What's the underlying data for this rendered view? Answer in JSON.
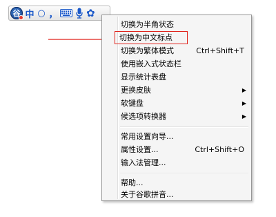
{
  "ime_bar": {
    "logo_text": "谷",
    "mode": "中",
    "fullhalf": "○",
    "punct": "，",
    "keyboard_icon": "keyboard-icon",
    "mic_icon": "microphone-icon",
    "settings_icon": "gear-icon",
    "accent": "#1a58c9"
  },
  "annotation": {
    "color": "#e0221a"
  },
  "menu": {
    "items": [
      {
        "label": "切换为半角状态"
      },
      {
        "label": "切换为中文标点"
      },
      {
        "label": "切换为繁体模式",
        "shortcut": "Ctrl+Shift+T"
      },
      {
        "label": "使用嵌入式状态栏"
      },
      {
        "label": "显示统计表盘"
      },
      {
        "label": "更换皮肤",
        "submenu": "▶"
      },
      {
        "label": "软键盘",
        "submenu": "▶"
      },
      {
        "label": "候选项转换器",
        "submenu": "▶"
      },
      {
        "label": "常用设置向导..."
      },
      {
        "label": "属性设置...",
        "shortcut": "Ctrl+Shift+O"
      },
      {
        "label": "输入法管理..."
      },
      {
        "label": "帮助..."
      },
      {
        "label": "关于谷歌拼音..."
      }
    ]
  }
}
